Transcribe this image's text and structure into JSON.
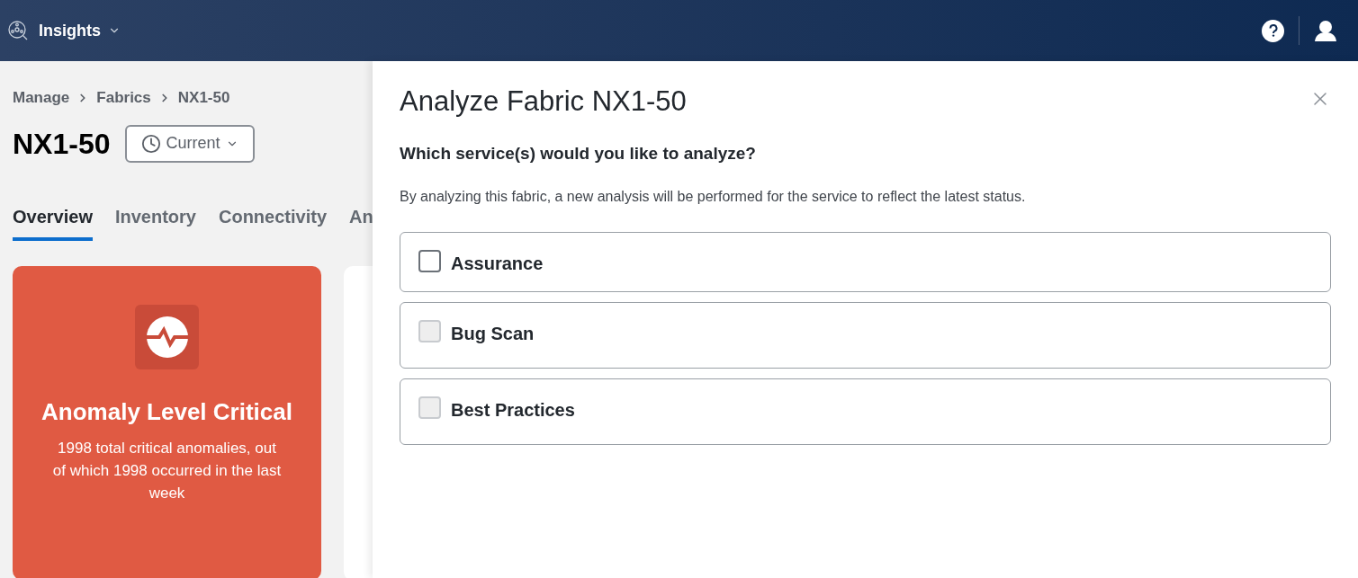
{
  "header": {
    "app_name": "Insights"
  },
  "breadcrumbs": [
    "Manage",
    "Fabrics",
    "NX1-50"
  ],
  "page_title": "NX1-50",
  "time_selector": {
    "label": "Current"
  },
  "tabs": [
    {
      "label": "Overview",
      "selected": true
    },
    {
      "label": "Inventory",
      "selected": false
    },
    {
      "label": "Connectivity",
      "selected": false
    },
    {
      "label": "An",
      "selected": false
    }
  ],
  "anomaly_card": {
    "title": "Anomaly Level Critical",
    "description": "1998 total critical anomalies, out of which 1998 occurred in the last week"
  },
  "drawer": {
    "title": "Analyze Fabric NX1-50",
    "question": "Which service(s) would you like to analyze?",
    "description": "By analyzing this fabric, a new analysis will be performed for the service to reflect the latest status.",
    "services": [
      {
        "label": "Assurance",
        "checked": false,
        "disabled": false
      },
      {
        "label": "Bug Scan",
        "checked": false,
        "disabled": true
      },
      {
        "label": "Best Practices",
        "checked": false,
        "disabled": true
      }
    ]
  }
}
